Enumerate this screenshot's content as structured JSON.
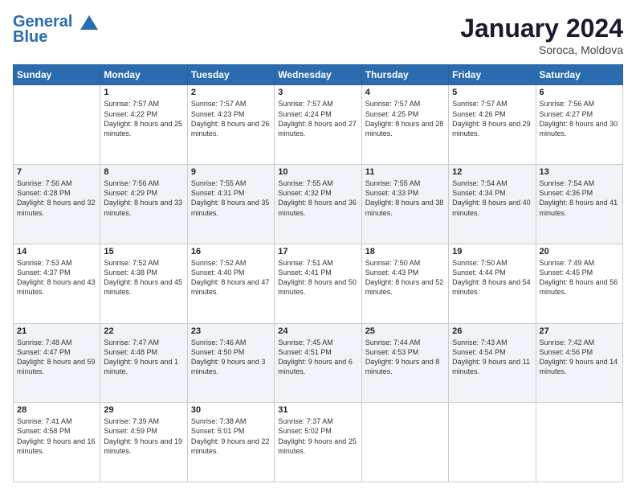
{
  "logo": {
    "line1": "General",
    "line2": "Blue"
  },
  "title": "January 2024",
  "subtitle": "Soroca, Moldova",
  "weekdays": [
    "Sunday",
    "Monday",
    "Tuesday",
    "Wednesday",
    "Thursday",
    "Friday",
    "Saturday"
  ],
  "weeks": [
    [
      {
        "day": null,
        "sunrise": null,
        "sunset": null,
        "daylight": null
      },
      {
        "day": "1",
        "sunrise": "7:57 AM",
        "sunset": "4:22 PM",
        "daylight": "8 hours and 25 minutes."
      },
      {
        "day": "2",
        "sunrise": "7:57 AM",
        "sunset": "4:23 PM",
        "daylight": "8 hours and 26 minutes."
      },
      {
        "day": "3",
        "sunrise": "7:57 AM",
        "sunset": "4:24 PM",
        "daylight": "8 hours and 27 minutes."
      },
      {
        "day": "4",
        "sunrise": "7:57 AM",
        "sunset": "4:25 PM",
        "daylight": "8 hours and 28 minutes."
      },
      {
        "day": "5",
        "sunrise": "7:57 AM",
        "sunset": "4:26 PM",
        "daylight": "8 hours and 29 minutes."
      },
      {
        "day": "6",
        "sunrise": "7:56 AM",
        "sunset": "4:27 PM",
        "daylight": "8 hours and 30 minutes."
      }
    ],
    [
      {
        "day": "7",
        "sunrise": "7:56 AM",
        "sunset": "4:28 PM",
        "daylight": "8 hours and 32 minutes."
      },
      {
        "day": "8",
        "sunrise": "7:56 AM",
        "sunset": "4:29 PM",
        "daylight": "8 hours and 33 minutes."
      },
      {
        "day": "9",
        "sunrise": "7:55 AM",
        "sunset": "4:31 PM",
        "daylight": "8 hours and 35 minutes."
      },
      {
        "day": "10",
        "sunrise": "7:55 AM",
        "sunset": "4:32 PM",
        "daylight": "8 hours and 36 minutes."
      },
      {
        "day": "11",
        "sunrise": "7:55 AM",
        "sunset": "4:33 PM",
        "daylight": "8 hours and 38 minutes."
      },
      {
        "day": "12",
        "sunrise": "7:54 AM",
        "sunset": "4:34 PM",
        "daylight": "8 hours and 40 minutes."
      },
      {
        "day": "13",
        "sunrise": "7:54 AM",
        "sunset": "4:36 PM",
        "daylight": "8 hours and 41 minutes."
      }
    ],
    [
      {
        "day": "14",
        "sunrise": "7:53 AM",
        "sunset": "4:37 PM",
        "daylight": "8 hours and 43 minutes."
      },
      {
        "day": "15",
        "sunrise": "7:52 AM",
        "sunset": "4:38 PM",
        "daylight": "8 hours and 45 minutes."
      },
      {
        "day": "16",
        "sunrise": "7:52 AM",
        "sunset": "4:40 PM",
        "daylight": "8 hours and 47 minutes."
      },
      {
        "day": "17",
        "sunrise": "7:51 AM",
        "sunset": "4:41 PM",
        "daylight": "8 hours and 50 minutes."
      },
      {
        "day": "18",
        "sunrise": "7:50 AM",
        "sunset": "4:43 PM",
        "daylight": "8 hours and 52 minutes."
      },
      {
        "day": "19",
        "sunrise": "7:50 AM",
        "sunset": "4:44 PM",
        "daylight": "8 hours and 54 minutes."
      },
      {
        "day": "20",
        "sunrise": "7:49 AM",
        "sunset": "4:45 PM",
        "daylight": "8 hours and 56 minutes."
      }
    ],
    [
      {
        "day": "21",
        "sunrise": "7:48 AM",
        "sunset": "4:47 PM",
        "daylight": "8 hours and 59 minutes."
      },
      {
        "day": "22",
        "sunrise": "7:47 AM",
        "sunset": "4:48 PM",
        "daylight": "9 hours and 1 minute."
      },
      {
        "day": "23",
        "sunrise": "7:46 AM",
        "sunset": "4:50 PM",
        "daylight": "9 hours and 3 minutes."
      },
      {
        "day": "24",
        "sunrise": "7:45 AM",
        "sunset": "4:51 PM",
        "daylight": "9 hours and 6 minutes."
      },
      {
        "day": "25",
        "sunrise": "7:44 AM",
        "sunset": "4:53 PM",
        "daylight": "9 hours and 8 minutes."
      },
      {
        "day": "26",
        "sunrise": "7:43 AM",
        "sunset": "4:54 PM",
        "daylight": "9 hours and 11 minutes."
      },
      {
        "day": "27",
        "sunrise": "7:42 AM",
        "sunset": "4:56 PM",
        "daylight": "9 hours and 14 minutes."
      }
    ],
    [
      {
        "day": "28",
        "sunrise": "7:41 AM",
        "sunset": "4:58 PM",
        "daylight": "9 hours and 16 minutes."
      },
      {
        "day": "29",
        "sunrise": "7:39 AM",
        "sunset": "4:59 PM",
        "daylight": "9 hours and 19 minutes."
      },
      {
        "day": "30",
        "sunrise": "7:38 AM",
        "sunset": "5:01 PM",
        "daylight": "9 hours and 22 minutes."
      },
      {
        "day": "31",
        "sunrise": "7:37 AM",
        "sunset": "5:02 PM",
        "daylight": "9 hours and 25 minutes."
      },
      null,
      null,
      null
    ]
  ]
}
